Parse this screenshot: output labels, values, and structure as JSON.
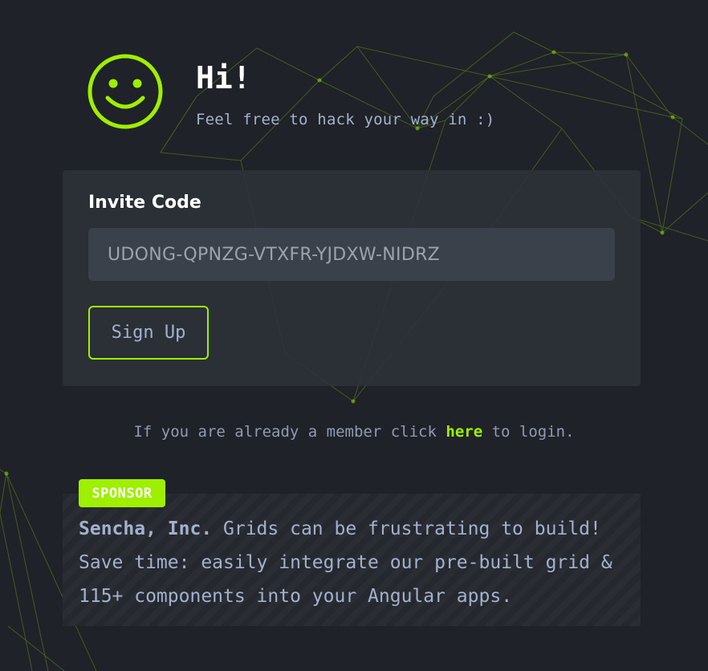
{
  "header": {
    "title": "Hi!",
    "subtitle": "Feel free to hack your way in :)",
    "icon": "smiley-face-icon"
  },
  "form": {
    "invite_label": "Invite Code",
    "invite_value": "UDONG-QPNZG-VTXFR-YJDXW-NIDRZ",
    "signup_label": "Sign Up"
  },
  "login": {
    "prefix": "If you are already a member click ",
    "link": "here",
    "suffix": " to login."
  },
  "sponsor": {
    "badge": "SPONSOR",
    "name": "Sencha, Inc.",
    "text": " Grids can be frustrating to build! Save time: easily integrate our pre-built grid & 115+ components into your Angular apps."
  },
  "colors": {
    "accent": "#9fef00",
    "background": "#1f2228",
    "card": "#2d3138",
    "input": "#3b414a"
  }
}
